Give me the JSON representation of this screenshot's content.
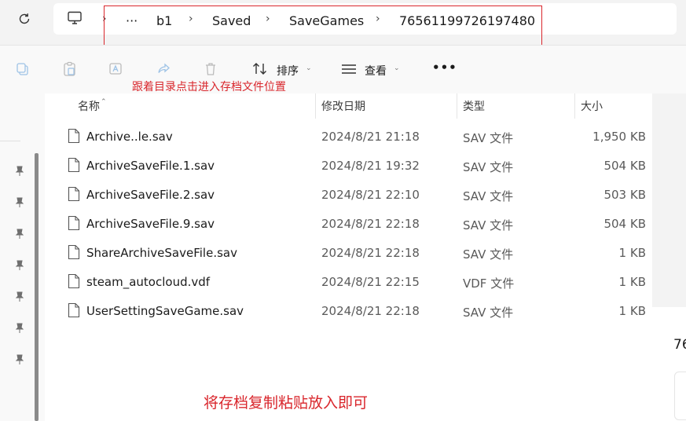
{
  "colors": {
    "accent_red": "#d9262c",
    "background": "#f3f3f3"
  },
  "toolbar_nav": {
    "refresh_icon": "refresh-icon"
  },
  "breadcrumb": {
    "computer_icon": "computer-icon",
    "items": [
      "···",
      "b1",
      "Saved",
      "SaveGames",
      "76561199726197480"
    ]
  },
  "commandbar": {
    "sort_label": "排序",
    "view_label": "查看",
    "more_label": "•••"
  },
  "annotations": {
    "top": "跟着目录点击进入存档文件位置",
    "bottom": "将存档复制粘贴放入即可"
  },
  "columns": {
    "name": "名称",
    "date": "修改日期",
    "type": "类型",
    "size": "大小"
  },
  "files": [
    {
      "name": "Archive..le.sav",
      "date": "2024/8/21 21:18",
      "type": "SAV 文件",
      "size": "1,950 KB"
    },
    {
      "name": "ArchiveSaveFile.1.sav",
      "date": "2024/8/21 19:32",
      "type": "SAV 文件",
      "size": "504 KB"
    },
    {
      "name": "ArchiveSaveFile.2.sav",
      "date": "2024/8/21 22:10",
      "type": "SAV 文件",
      "size": "503 KB"
    },
    {
      "name": "ArchiveSaveFile.9.sav",
      "date": "2024/8/21 22:18",
      "type": "SAV 文件",
      "size": "504 KB"
    },
    {
      "name": "ShareArchiveSaveFile.sav",
      "date": "2024/8/21 22:18",
      "type": "SAV 文件",
      "size": "1 KB"
    },
    {
      "name": "steam_autocloud.vdf",
      "date": "2024/8/21 22:15",
      "type": "VDF 文件",
      "size": "1 KB"
    },
    {
      "name": "UserSettingSaveGame.sav",
      "date": "2024/8/21 22:18",
      "type": "SAV 文件",
      "size": "1 KB"
    }
  ],
  "details": {
    "partial_text": "76"
  }
}
